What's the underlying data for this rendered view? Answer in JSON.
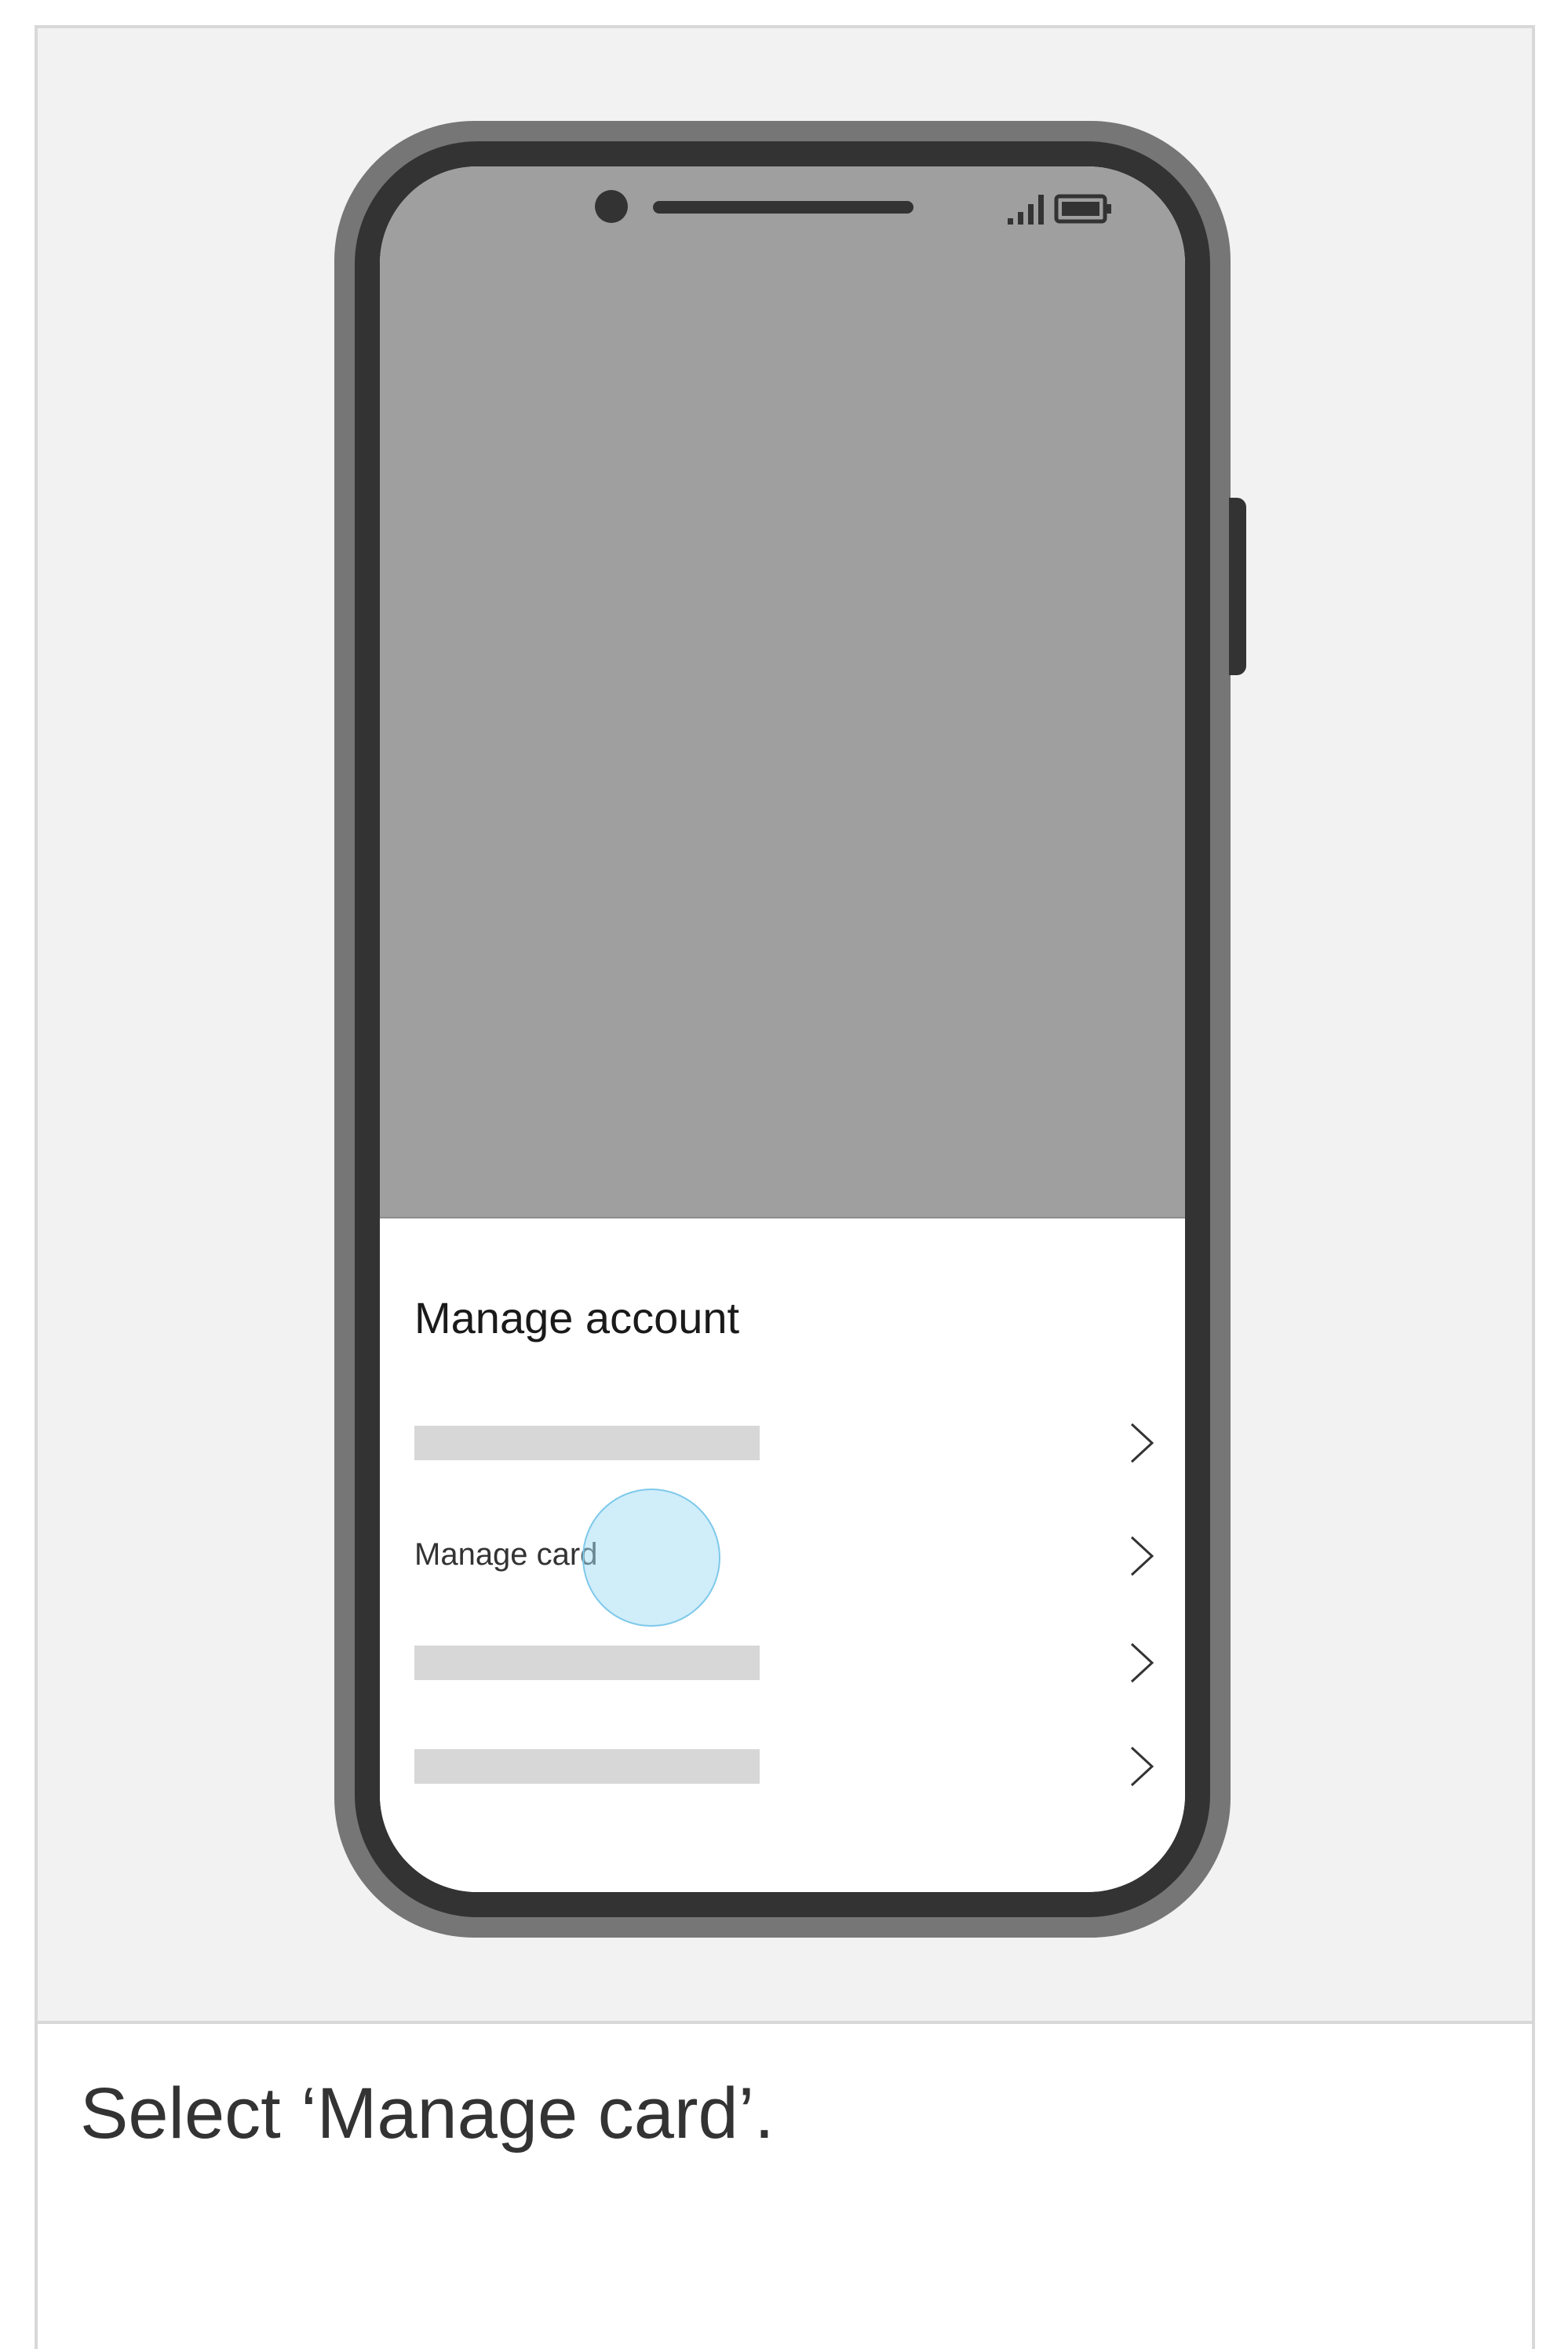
{
  "screen": {
    "sheet": {
      "title": "Manage account",
      "rows": [
        {
          "type": "placeholder",
          "label": ""
        },
        {
          "type": "text",
          "label": "Manage card"
        },
        {
          "type": "placeholder",
          "label": ""
        },
        {
          "type": "placeholder",
          "label": ""
        }
      ]
    },
    "icons": {
      "signal": "signal-strength-icon",
      "battery": "battery-icon",
      "row_arrow": "chevron-right-icon",
      "tap": "tap-indicator"
    }
  },
  "caption": {
    "text": "Select ‘Manage card’."
  },
  "colors": {
    "background": "#f2f2f2",
    "phone_frame": "#767676",
    "phone_bezel": "#333333",
    "screen_upper": "#9f9f9f",
    "placeholder": "#d7d7d7",
    "tap_highlight": "#a1dcf5"
  }
}
